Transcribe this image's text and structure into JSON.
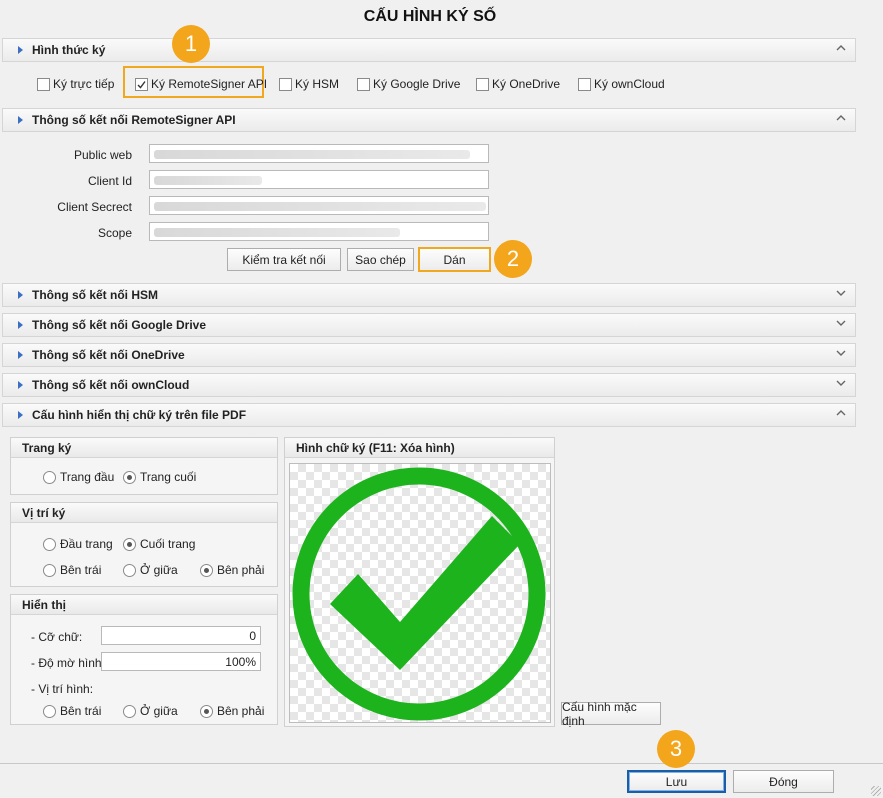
{
  "title": "CẤU HÌNH KÝ SỐ",
  "sections": {
    "hinh_thuc_ky": "Hình thức ký",
    "remote_signer": "Thông số kết nối RemoteSigner API",
    "hsm": "Thông số kết nối HSM",
    "google_drive": "Thông số kết nối Google Drive",
    "onedrive": "Thông số kết nối OneDrive",
    "owncloud": "Thông số kết nối ownCloud",
    "pdf_display": "Cấu hình hiển thị chữ ký trên file PDF"
  },
  "sign_methods": [
    {
      "label": "Ký trực tiếp",
      "checked": false
    },
    {
      "label": "Ký RemoteSigner API",
      "checked": true
    },
    {
      "label": "Ký HSM",
      "checked": false
    },
    {
      "label": "Ký Google Drive",
      "checked": false
    },
    {
      "label": "Ký OneDrive",
      "checked": false
    },
    {
      "label": "Ký ownCloud",
      "checked": false
    }
  ],
  "remote_fields": {
    "public_web": "Public web",
    "client_id": "Client Id",
    "client_secret": "Client Secrect",
    "scope": "Scope"
  },
  "remote_buttons": {
    "test": "Kiểm tra kết nối",
    "copy": "Sao chép",
    "paste": "Dán"
  },
  "badges": {
    "b1": "1",
    "b2": "2",
    "b3": "3"
  },
  "trang_ky": {
    "header": "Trang ký",
    "first": "Trang đầu",
    "last": "Trang cuối",
    "selected": "last"
  },
  "vi_tri_ky": {
    "header": "Vị trí ký",
    "top": "Đầu trang",
    "bottom": "Cuối trang",
    "left": "Bên trái",
    "middle": "Ở giữa",
    "right": "Bên phải"
  },
  "hien_thi": {
    "header": "Hiển thị",
    "font_size_label": "- Cỡ chữ:",
    "font_size": "0",
    "opacity_label": "- Độ mờ hình:",
    "opacity": "100%",
    "image_pos_label": "- Vị trí hình:",
    "left": "Bên trái",
    "middle": "Ở giữa",
    "right": "Bên phải"
  },
  "signature_image": {
    "header": "Hình chữ ký (F11: Xóa hình)",
    "default_button": "Cấu hình mặc định"
  },
  "footer": {
    "save": "Lưu",
    "close": "Đóng"
  },
  "colors": {
    "accent": "#f0a81e",
    "checkmark": "#1db31d",
    "section_arrow": "#3b6fc4"
  }
}
